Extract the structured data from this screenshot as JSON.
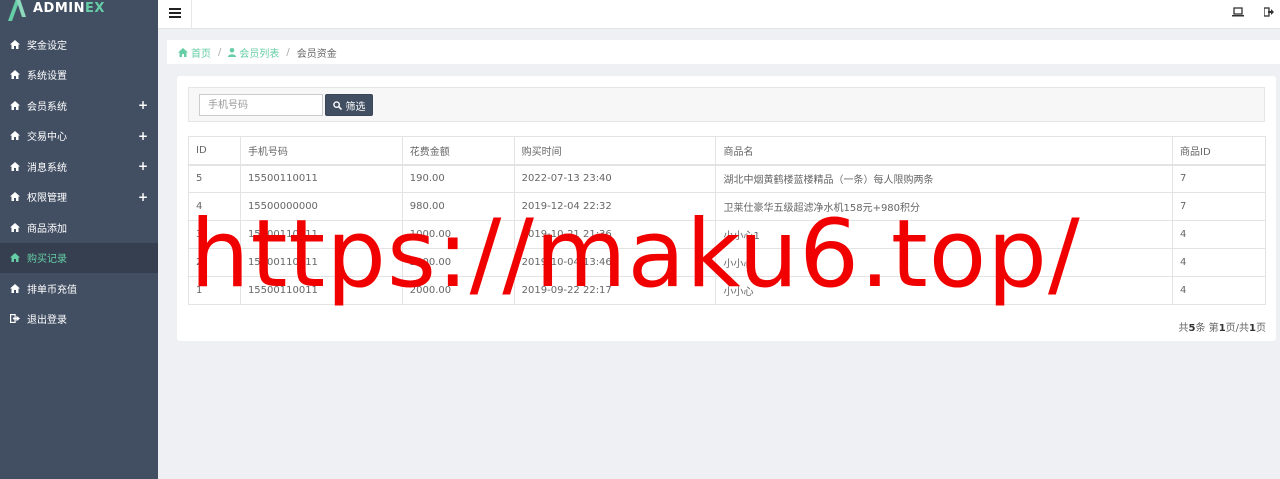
{
  "brand": {
    "name_part1": "ADMIN",
    "name_part2": "EX"
  },
  "sidebar": {
    "items": [
      {
        "label": "奖金设定",
        "icon": "home-icon",
        "expandable": false
      },
      {
        "label": "系统设置",
        "icon": "home-icon",
        "expandable": false
      },
      {
        "label": "会员系统",
        "icon": "home-icon",
        "expandable": true
      },
      {
        "label": "交易中心",
        "icon": "home-icon",
        "expandable": true
      },
      {
        "label": "消息系统",
        "icon": "home-icon",
        "expandable": true
      },
      {
        "label": "权限管理",
        "icon": "home-icon",
        "expandable": true
      },
      {
        "label": "商品添加",
        "icon": "home-icon",
        "expandable": false
      },
      {
        "label": "购买记录",
        "icon": "home-icon",
        "expandable": false,
        "active": true
      },
      {
        "label": "排单币充值",
        "icon": "home-icon",
        "expandable": false
      },
      {
        "label": "退出登录",
        "icon": "sign-out-icon",
        "expandable": false
      }
    ],
    "expand_symbol": "+"
  },
  "breadcrumb": {
    "home": "首页",
    "member_list": "会员列表",
    "current": "会员资金",
    "separator": "/"
  },
  "filter": {
    "phone_placeholder": "手机号码",
    "phone_value": "",
    "button_label": "筛选"
  },
  "table": {
    "columns": [
      "ID",
      "手机号码",
      "花费金额",
      "购买时间",
      "商品名",
      "商品ID"
    ],
    "rows": [
      [
        "5",
        "15500110011",
        "190.00",
        "2022-07-13 23:40",
        "湖北中烟黄鹤楼蓝楼精品（一条）每人限购两条",
        "7"
      ],
      [
        "4",
        "15500000000",
        "980.00",
        "2019-12-04 22:32",
        "卫莱仕豪华五级超滤净水机158元+980积分",
        "7"
      ],
      [
        "3",
        "15500110011",
        "1000.00",
        "2019-10-21 21:36",
        "小小心1",
        "4"
      ],
      [
        "2",
        "15500110011",
        "2000.00",
        "2019-10-04 13:46",
        "小小心",
        "4"
      ],
      [
        "1",
        "15500110011",
        "2000.00",
        "2019-09-22 22:17",
        "小小心",
        "4"
      ]
    ]
  },
  "pager": {
    "prefix": "共",
    "total": "5",
    "mid1": "条 第",
    "page": "1",
    "mid2": "页/共",
    "pages": "1",
    "suffix": "页"
  },
  "watermark": "https://maku6.top/",
  "colors": {
    "sidebar_bg": "#424f63",
    "sidebar_active_bg": "#353f4f",
    "accent": "#65cea7",
    "watermark": "#f10000",
    "button_bg": "#424f63"
  }
}
